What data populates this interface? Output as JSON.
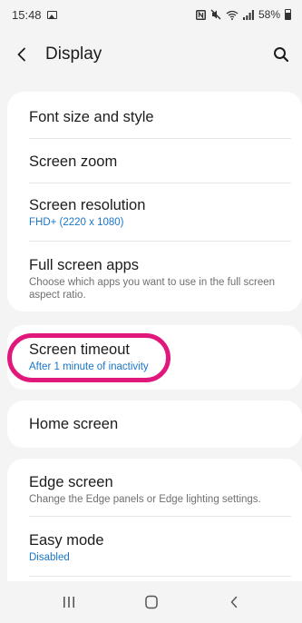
{
  "status_bar": {
    "time": "15:48",
    "battery": "58%",
    "icons": [
      "gallery-icon",
      "nfc-icon",
      "mute-icon",
      "wifi-icon",
      "signal-icon",
      "battery-icon"
    ]
  },
  "header": {
    "title": "Display",
    "back_icon": "chevron-left-icon",
    "search_icon": "search-icon"
  },
  "sections": {
    "group1": [
      {
        "title": "Font size and style",
        "subtitle": ""
      },
      {
        "title": "Screen zoom",
        "subtitle": ""
      },
      {
        "title": "Screen resolution",
        "subtitle": "FHD+ (2220 x 1080)"
      },
      {
        "title": "Full screen apps",
        "subtitle": "Choose which apps you want to use in the full screen aspect ratio."
      }
    ],
    "group2": [
      {
        "title": "Screen timeout",
        "subtitle": "After 1 minute of inactivity"
      }
    ],
    "group3": [
      {
        "title": "Home screen",
        "subtitle": ""
      }
    ],
    "group4": [
      {
        "title": "Edge screen",
        "subtitle": "Change the Edge panels or Edge lighting settings."
      },
      {
        "title": "Easy mode",
        "subtitle": "Disabled"
      }
    ]
  },
  "navbar": {
    "icons": [
      "recent-apps-icon",
      "home-icon",
      "back-icon"
    ]
  },
  "colors": {
    "accent_subtitle": "#1976c8",
    "highlight": "#e0187c",
    "background": "#f4f4f4"
  }
}
